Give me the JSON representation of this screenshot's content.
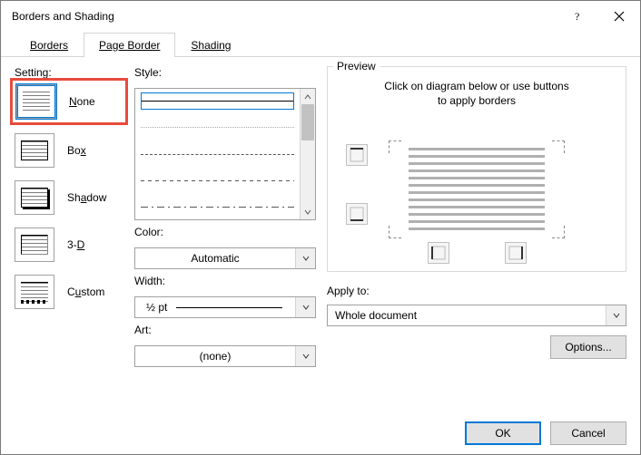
{
  "window": {
    "title": "Borders and Shading"
  },
  "tabs": {
    "borders": "Borders",
    "page_border": "Page Border",
    "shading": "Shading",
    "active": "page_border"
  },
  "setting": {
    "label": "Setting:",
    "items": [
      {
        "id": "none",
        "label": "None",
        "selected": true
      },
      {
        "id": "box",
        "label": "Box",
        "selected": false
      },
      {
        "id": "shadow",
        "label": "Shadow",
        "selected": false
      },
      {
        "id": "3d",
        "label": "3-D",
        "selected": false
      },
      {
        "id": "custom",
        "label": "Custom",
        "selected": false
      }
    ]
  },
  "style": {
    "label": "Style:"
  },
  "color": {
    "label": "Color:",
    "value": "Automatic"
  },
  "width": {
    "label": "Width:",
    "value": "½ pt"
  },
  "art": {
    "label": "Art:",
    "value": "(none)"
  },
  "preview": {
    "label": "Preview",
    "hint1": "Click on diagram below or use buttons",
    "hint2": "to apply borders"
  },
  "apply": {
    "label": "Apply to:",
    "value": "Whole document"
  },
  "buttons": {
    "options": "Options...",
    "ok": "OK",
    "cancel": "Cancel"
  }
}
